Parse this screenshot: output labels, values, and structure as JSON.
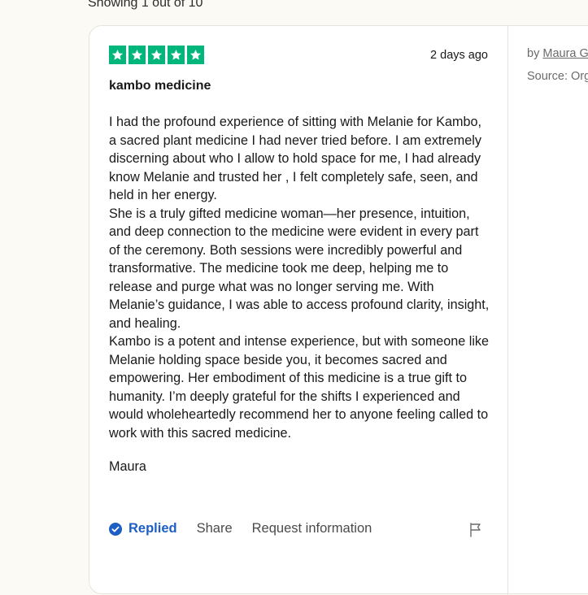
{
  "header": {
    "showing_text": "Showing 1 out of 10"
  },
  "review": {
    "rating": 5,
    "rating_color": "#00b67a",
    "date": "2 days ago",
    "title": "kambo medicine",
    "paragraphs": [
      "I had the profound experience of sitting with Melanie for Kambo, a sacred plant medicine I had never tried before. I am extremely discerning about who I allow to hold space for me, I had already know Melanie and trusted her , I felt completely safe, seen, and held in her energy.",
      "She is a truly gifted medicine woman—her presence, intuition, and deep connection to the medicine were evident in every part of the ceremony. Both sessions were incredibly powerful and transformative. The medicine took me deep, helping me to release and purge what was no longer serving me. With Melanie’s guidance, I was able to access profound clarity, insight, and healing.",
      "Kambo is a potent and intense experience, but with someone like Melanie holding space beside you, it becomes sacred and empowering. Her embodiment of this medicine is a true gift to humanity. I’m deeply grateful for the shifts I experienced and would wholeheartedly recommend her to anyone feeling called to work with this sacred medicine."
    ],
    "signature": "Maura"
  },
  "actions": {
    "replied_label": "Replied",
    "share_label": "Share",
    "request_label": "Request information",
    "replied_color": "#1c5ec4",
    "icons": {
      "replied": "check-circle-icon",
      "report": "flag-icon"
    }
  },
  "sidebar": {
    "by_prefix": "by",
    "author": "Maura G",
    "source_text": "Source: Org"
  }
}
